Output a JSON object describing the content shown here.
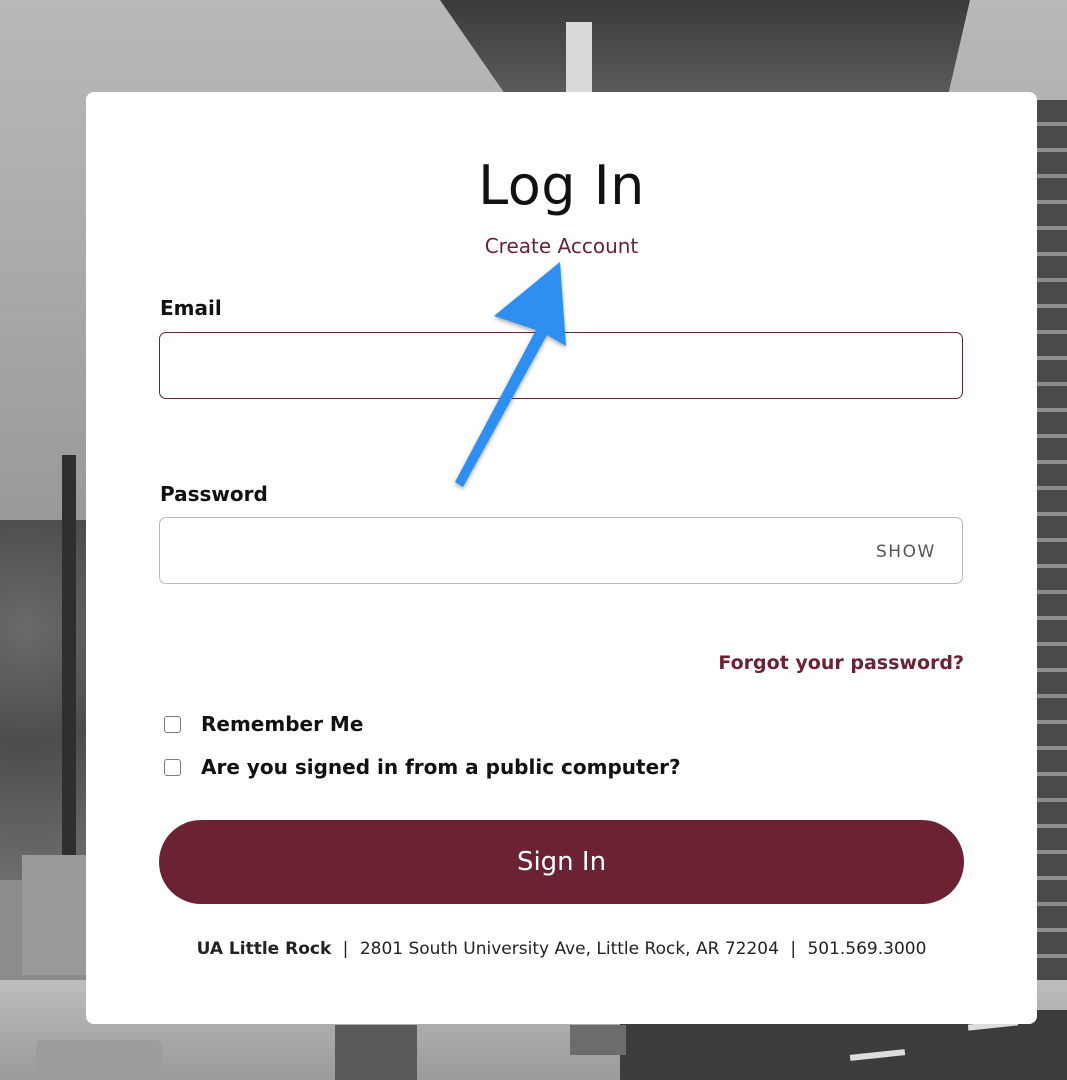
{
  "login": {
    "title": "Log In",
    "create_account": "Create Account",
    "email": {
      "label": "Email",
      "value": ""
    },
    "password": {
      "label": "Password",
      "value": "",
      "show_label": "SHOW"
    },
    "forgot_password": "Forgot your password?",
    "remember_me": {
      "label": "Remember Me",
      "checked": false
    },
    "public_computer": {
      "label": "Are you signed in from a public computer?",
      "checked": false
    },
    "sign_in": "Sign In"
  },
  "footer": {
    "org": "UA Little Rock",
    "address": "2801 South University Ave, Little Rock, AR 72204",
    "phone": "501.569.3000",
    "separator": "|"
  },
  "colors": {
    "brand": "#6b2233",
    "arrow": "#2e8ff0"
  }
}
